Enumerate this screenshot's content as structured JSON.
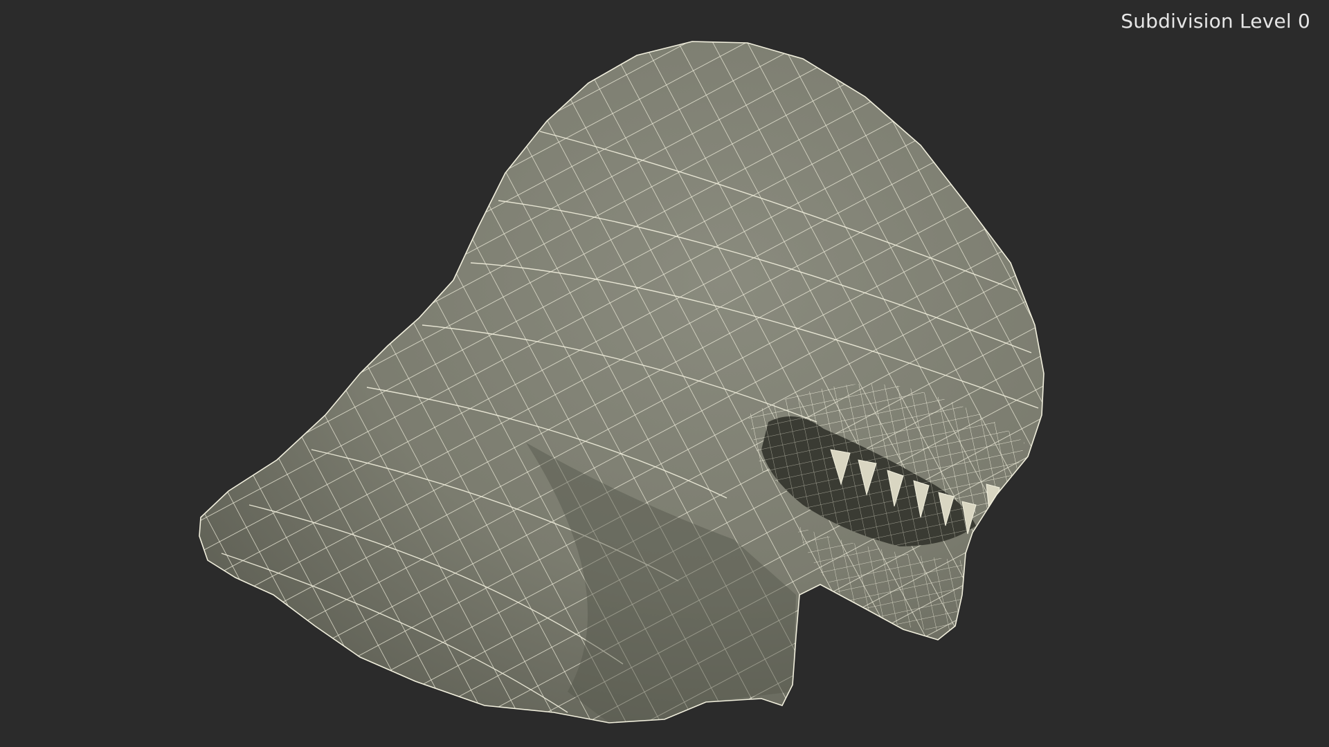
{
  "viewport": {
    "subdivision_label": "Subdivision Level 0",
    "background_color": "#2b2b2b",
    "mesh_fill_color": "#7e7f72",
    "wire_color": "#f2f0de"
  }
}
